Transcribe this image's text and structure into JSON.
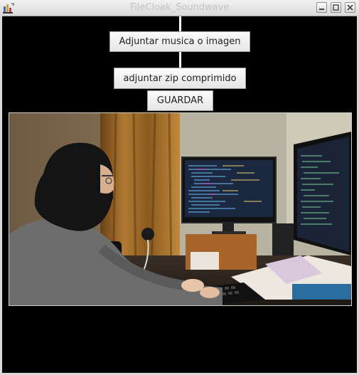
{
  "window": {
    "title": "FileCloak_Soundwave",
    "icon": "java-app-icon",
    "controls": [
      "minimize-icon",
      "maximize-icon",
      "close-icon"
    ]
  },
  "buttons": {
    "attach_media_label": "Adjuntar musica o imagen",
    "attach_zip_label": "adjuntar zip comprimido",
    "save_label": "GUARDAR"
  },
  "preview": {
    "content": "photo-hooded-person-at-computer"
  },
  "colors": {
    "frame_background": "#000000",
    "titlebar": "#e0e0e0",
    "button_background": "#f0f0f0"
  }
}
